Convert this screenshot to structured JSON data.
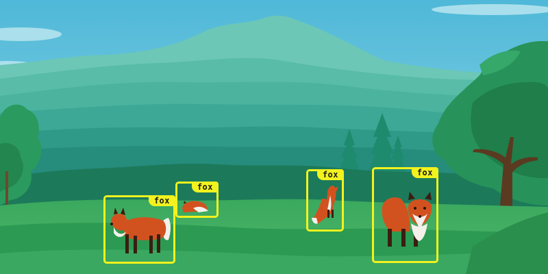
{
  "palette": {
    "sky": "#5fc4dc",
    "mountain": "#5dbfae",
    "forest": "#1f8c78",
    "grass": "#2f9e55",
    "fox_orange": "#d2521f",
    "box": "#f2f21e"
  },
  "detections": [
    {
      "label": "fox"
    },
    {
      "label": "fox"
    },
    {
      "label": "fox"
    },
    {
      "label": "fox"
    }
  ]
}
